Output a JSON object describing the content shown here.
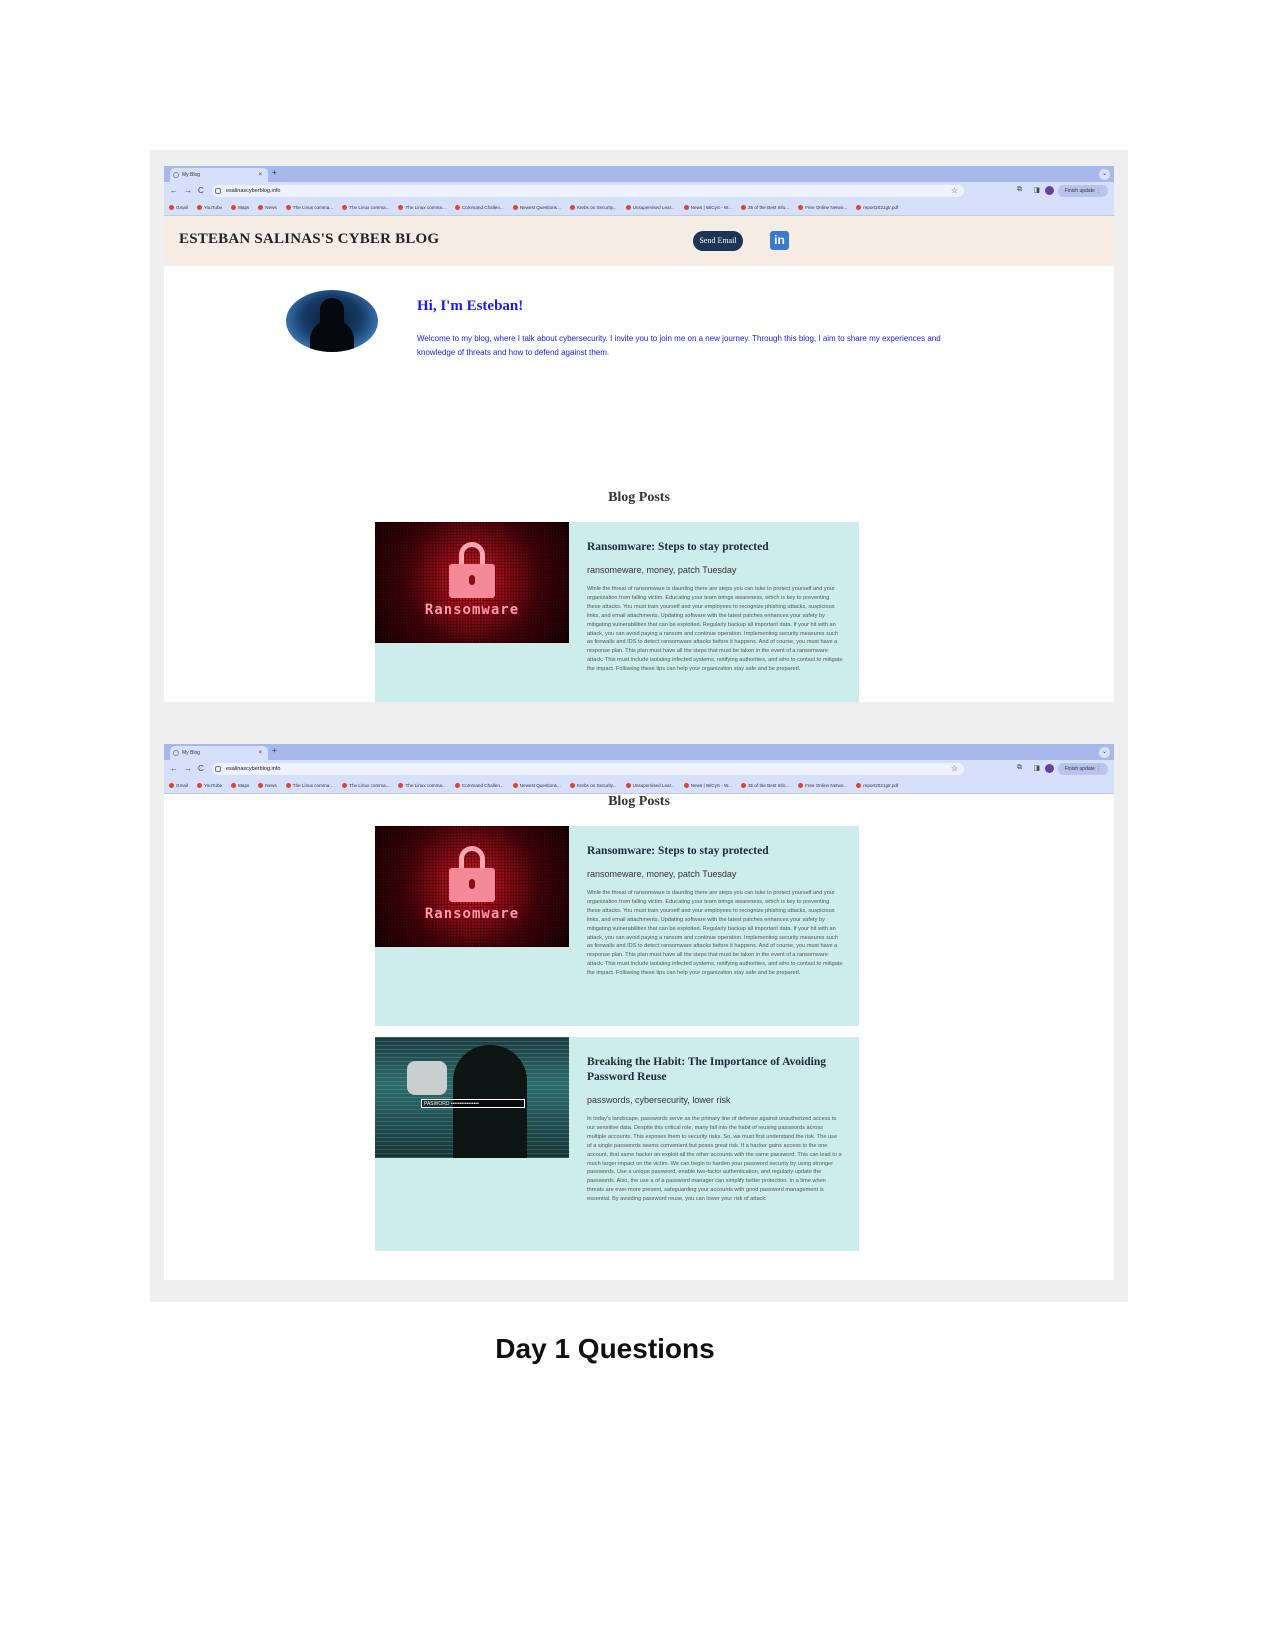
{
  "browser": {
    "tab_title": "My Blog",
    "tab_close": "×",
    "new_tab": "+",
    "tab_menu": "⌄",
    "url": "esalinascyberblog.info",
    "back": "←",
    "forward": "→",
    "reload": "C",
    "star": "☆",
    "finish_update": "Finish update ⋮",
    "bookmarks": [
      "Gmail",
      "YouTube",
      "Maps",
      "News",
      "The Linux comma...",
      "The Linux comma...",
      "The Linux comma...",
      "Command Challen...",
      "Newest Questions...",
      "Krebs on Security...",
      "Unsupervised Lear...",
      "News | WiCyS - W...",
      "35 of the Best Info...",
      "Free Online Netwo...",
      "report2021gtr.pdf"
    ]
  },
  "blog": {
    "title": "ESTEBAN SALINAS'S CYBER BLOG",
    "send_email": "Send Email",
    "linkedin": "in",
    "greeting": "Hi, I'm Esteban!",
    "intro": "Welcome to my blog, where I talk about cybersecurity. I invite you to join me on a new journey. Through this blog, I aim to share my experiences and knowledge of threats and how to defend against them.",
    "posts_heading": "Blog Posts"
  },
  "posts": [
    {
      "image_text": "Ransomware",
      "title": "Ransomware: Steps to stay protected",
      "tags": "ransomeware, money, patch Tuesday",
      "body": "While the threat of ransomware is daunting there are steps you can take to protect yourself and your organization from falling victim. Educating your team brings awareness, which is key to preventing these attacks. You must train yourself and your employees to recognize phishing attacks, suspicious links, and email attachments. Updating software with the latest patches enhances your safety by mitigating vulnerabilities that can be exploited. Regularly backup all important data. If your hit with an attack, you can avoid paying a ransom and continue operation. Implementing security measures such as firewalls and IDS to detect ransomware attacks before it happens. And of course, you must have a response plan. This plan must have all the steps that must be taken in the event of a ransomware attack. This must include isolating infected systems, notifying authorities, and who to contact to mitigate the impact. Following these tips can help your organization stay safe and be prepared."
    },
    {
      "image_text": "PASWORD ••••••••••••••••",
      "title": "Breaking the Habit: The Importance of Avoiding Password Reuse",
      "tags": "passwords, cybersecurity, lower risk",
      "body": "In today's landscape, passwords serve as the primary line of defense against unauthorized access to our sensitive data. Despite this critical role, many fall into the habit of reusing passwords across multiple accounts. This exposes them to security risks. So, we must first understand the risk. The use of a single passwords seems convenient but poses great risk. If a hacker gains access to the one account, that same hacker an exploit all the other accounts with the same password. This can lead to a much larger impact on the victim. We can begin to harden your password security by using stronger passwords. Use a unique password, enable two-factor authentication, and regularly update the passwords. Also, the use a of a password manager can simplify better protection. In a time when threats are ever-more present, safeguarding your accounts with good password management is essential. By avoiding password reuse, you can lower your risk of attack."
    }
  ],
  "caption": "Day 1 Questions"
}
